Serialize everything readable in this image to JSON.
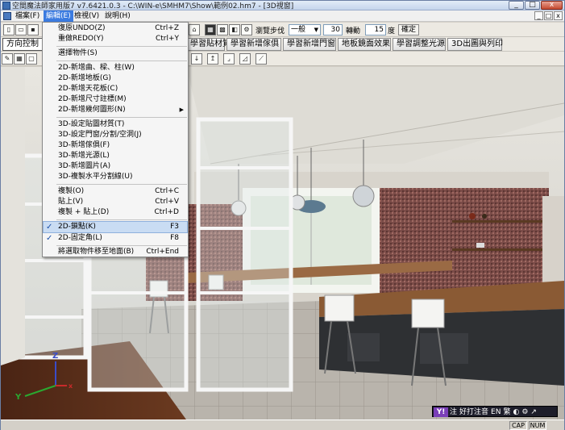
{
  "window": {
    "title": "空間魔法師家用版7 v7.6421.0.3 - C:\\WIN-e\\SMHM7\\Show\\範例02.hm7 - [3D視窗]",
    "controls": [
      "_",
      "□",
      "x"
    ]
  },
  "menubar": {
    "items": [
      {
        "label": "檔案(F)"
      },
      {
        "label": "編輯(E)"
      },
      {
        "label": "檢視(V)"
      },
      {
        "label": "說明(H)"
      }
    ],
    "mdi_controls": [
      "_",
      "□",
      "x"
    ]
  },
  "toolbar1": {
    "step_label": "瀏覽步伐",
    "step_value": "一般",
    "value1": "30",
    "rotate_label": "轉動",
    "value2": "15",
    "unit": "度",
    "confirm": "確定"
  },
  "toolbar2": {
    "tabs": [
      {
        "label": "方向控制"
      },
      {
        "label": "學習貼材質"
      },
      {
        "label": "學習新增傢俱"
      },
      {
        "label": "學習新增門窗"
      },
      {
        "label": "地板鏡面效果"
      },
      {
        "label": "學習調整光源"
      },
      {
        "label": "3D出圖與列印"
      }
    ]
  },
  "edit_menu": {
    "items": [
      {
        "label": "復原UNDO(Z)",
        "shortcut": "Ctrl+Z"
      },
      {
        "label": "重做REDO(Y)",
        "shortcut": "Ctrl+Y"
      },
      {
        "label": "選擇物件(S)",
        "shortcut": ""
      },
      {
        "label": "2D-新增曲、樑、柱(W)",
        "shortcut": ""
      },
      {
        "label": "2D-新增地板(G)",
        "shortcut": ""
      },
      {
        "label": "2D-新增天花板(C)",
        "shortcut": ""
      },
      {
        "label": "2D-新增尺寸註標(M)",
        "shortcut": ""
      },
      {
        "label": "2D-新增幾何圖形(N)",
        "shortcut": ""
      },
      {
        "label": "3D-設定貼圖材質(T)",
        "shortcut": ""
      },
      {
        "label": "3D-設定門窗/分割/空洞(J)",
        "shortcut": ""
      },
      {
        "label": "3D-新增傢俱(F)",
        "shortcut": ""
      },
      {
        "label": "3D-新增光源(L)",
        "shortcut": ""
      },
      {
        "label": "3D-新增圖片(A)",
        "shortcut": ""
      },
      {
        "label": "3D-複製水平分割線(U)",
        "shortcut": ""
      },
      {
        "label": "複製(O)",
        "shortcut": "Ctrl+C"
      },
      {
        "label": "貼上(V)",
        "shortcut": "Ctrl+V"
      },
      {
        "label": "複製 + 貼上(D)",
        "shortcut": "Ctrl+D"
      },
      {
        "label": "2D-鎖點(K)",
        "shortcut": "F3"
      },
      {
        "label": "2D-固定角(L)",
        "shortcut": "F8"
      },
      {
        "label": "將選取物件移至地面(B)",
        "shortcut": "Ctrl+End"
      }
    ]
  },
  "axes": {
    "z": "Z",
    "y": "Y",
    "x": "x"
  },
  "ime": {
    "items": [
      "注",
      "好打注音",
      "EN",
      "繁"
    ]
  },
  "statusbar": {
    "cap": "CAP",
    "num": "NUM"
  },
  "colors": {
    "menu_highlight": "#3b7be0",
    "menu_hover": "#c9dcf3",
    "floor": "#5a2a1a",
    "wall_accent": "#7a4a48"
  }
}
